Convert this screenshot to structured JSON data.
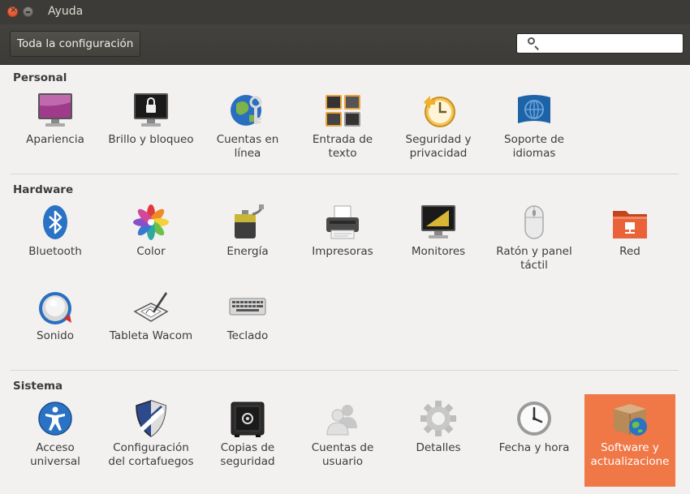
{
  "window": {
    "title": "Ayuda",
    "close_glyph": "×"
  },
  "toolbar": {
    "all_settings_label": "Toda la configuración",
    "search_placeholder": "",
    "search_value": ""
  },
  "sections": {
    "personal": {
      "title": "Personal",
      "items": [
        {
          "label": "Apariencia",
          "icon": "appearance-icon"
        },
        {
          "label": "Brillo y bloqueo",
          "icon": "brightness-lock-icon"
        },
        {
          "label": "Cuentas en línea",
          "icon": "online-accounts-icon"
        },
        {
          "label": "Entrada de texto",
          "icon": "text-entry-icon"
        },
        {
          "label": "Seguridad y privacidad",
          "icon": "security-privacy-icon"
        },
        {
          "label": "Soporte de idiomas",
          "icon": "language-support-icon"
        }
      ]
    },
    "hardware": {
      "title": "Hardware",
      "items": [
        {
          "label": "Bluetooth",
          "icon": "bluetooth-icon"
        },
        {
          "label": "Color",
          "icon": "color-icon"
        },
        {
          "label": "Energía",
          "icon": "power-icon"
        },
        {
          "label": "Impresoras",
          "icon": "printer-icon"
        },
        {
          "label": "Monitores",
          "icon": "monitor-icon"
        },
        {
          "label": "Ratón y panel táctil",
          "icon": "mouse-icon"
        },
        {
          "label": "Red",
          "icon": "network-icon"
        },
        {
          "label": "Sonido",
          "icon": "sound-icon"
        },
        {
          "label": "Tableta Wacom",
          "icon": "tablet-icon"
        },
        {
          "label": "Teclado",
          "icon": "keyboard-icon"
        }
      ]
    },
    "system": {
      "title": "Sistema",
      "items": [
        {
          "label": "Acceso universal",
          "icon": "universal-access-icon"
        },
        {
          "label": "Configuración del cortafuegos",
          "icon": "firewall-icon"
        },
        {
          "label": "Copias de seguridad",
          "icon": "backup-icon"
        },
        {
          "label": "Cuentas de usuario",
          "icon": "user-accounts-icon"
        },
        {
          "label": "Detalles",
          "icon": "details-icon"
        },
        {
          "label": "Fecha y hora",
          "icon": "date-time-icon"
        },
        {
          "label": "Software y actualizacione",
          "icon": "software-updates-icon",
          "selected": true
        }
      ]
    }
  },
  "colors": {
    "titlebar": "#3c3b37",
    "selection": "#f07746",
    "background": "#f2f1f0"
  }
}
